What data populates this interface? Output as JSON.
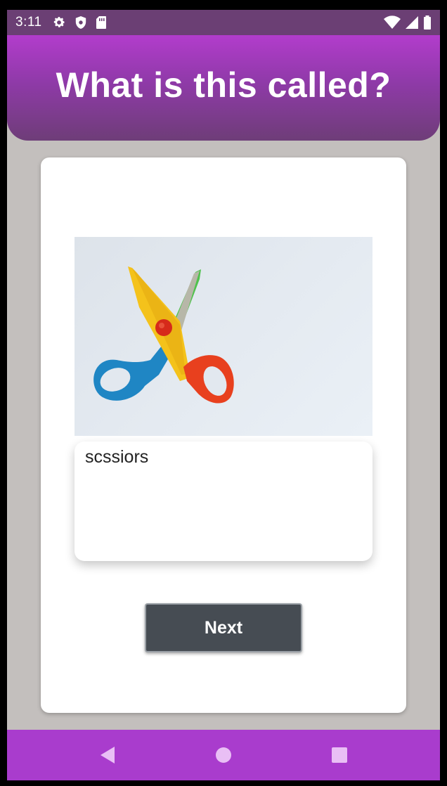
{
  "status_bar": {
    "time": "3:11",
    "left_icons": [
      "gear-icon",
      "shield-icon",
      "sd-card-icon"
    ],
    "right_icons": [
      "wifi-icon",
      "cell-signal-icon",
      "battery-icon"
    ]
  },
  "header": {
    "title": "What is this called?",
    "gradient_colors": [
      "#b23ccc",
      "#6e3d78"
    ]
  },
  "quiz": {
    "image_subject": "scissors-image",
    "answer_text": "scssiors",
    "next_label": "Next"
  },
  "nav_bar": {
    "background": "#a93ccd",
    "buttons": [
      "back-icon",
      "home-icon",
      "recents-icon"
    ]
  }
}
